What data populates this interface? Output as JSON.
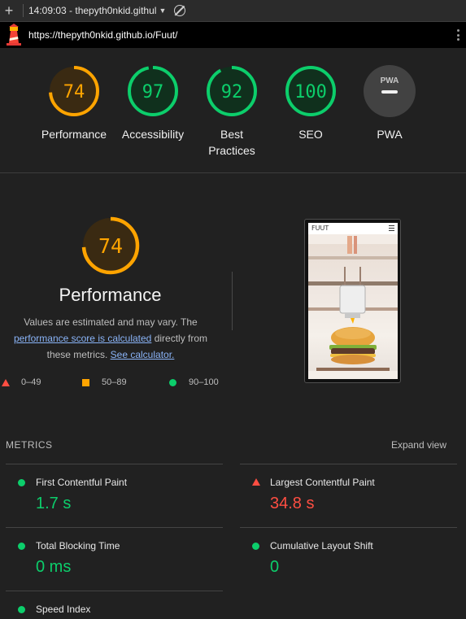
{
  "toolbar": {
    "title": "14:09:03 - thepyth0nkid.githul",
    "plus_icon": "plus-icon",
    "caret_icon": "chevron-down-icon",
    "clear_icon": "no-entry-icon"
  },
  "urlbar": {
    "url": "https://thepyth0nkid.github.io/Fuut/"
  },
  "colors": {
    "pass": "#0cce6b",
    "average": "#ffa400",
    "fail": "#ff4e42",
    "link": "#8ab4f8"
  },
  "categories": [
    {
      "score": "74",
      "label": "Performance",
      "status": "average"
    },
    {
      "score": "97",
      "label": "Accessibility",
      "status": "pass"
    },
    {
      "score": "92",
      "label": "Best Practices",
      "status": "pass"
    },
    {
      "score": "100",
      "label": "SEO",
      "status": "pass"
    },
    {
      "score": "",
      "label": "PWA",
      "status": "na",
      "badge": "PWA"
    }
  ],
  "performance": {
    "score": "74",
    "title": "Performance",
    "desc_1": "Values are estimated and may vary. The",
    "desc_link": "performance score is calculated",
    "desc_2": "directly from these metrics.",
    "calc_link": "See calculator.",
    "legend": [
      {
        "range": "0–49",
        "shape": "triangle"
      },
      {
        "range": "50–89",
        "shape": "square"
      },
      {
        "range": "90–100",
        "shape": "circle"
      }
    ]
  },
  "screenshot": {
    "brand": "FUUT"
  },
  "metrics": {
    "heading": "METRICS",
    "expand_label": "Expand view",
    "items": [
      {
        "name": "First Contentful Paint",
        "value": "1.7 s",
        "status": "pass"
      },
      {
        "name": "Largest Contentful Paint",
        "value": "34.8 s",
        "status": "fail"
      },
      {
        "name": "Total Blocking Time",
        "value": "0 ms",
        "status": "pass"
      },
      {
        "name": "Cumulative Layout Shift",
        "value": "0",
        "status": "pass"
      },
      {
        "name": "Speed Index",
        "value": "",
        "status": "pass"
      }
    ]
  }
}
